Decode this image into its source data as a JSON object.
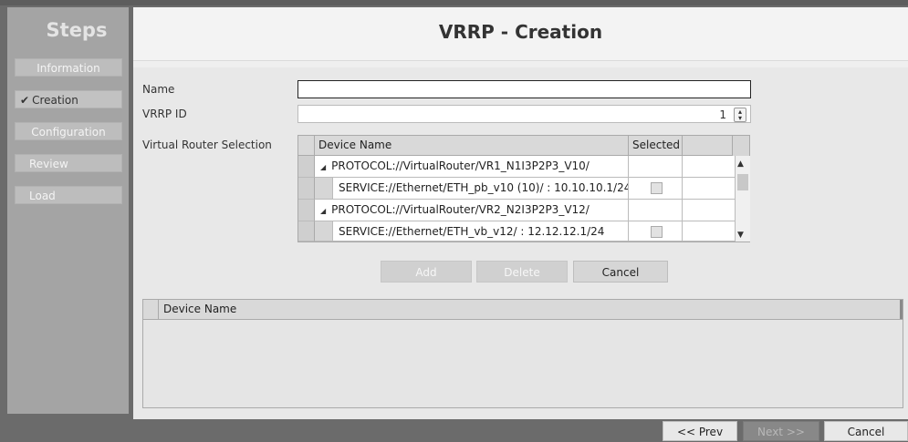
{
  "sidebar": {
    "title": "Steps",
    "steps": [
      {
        "label": "Information"
      },
      {
        "label": "Creation",
        "check": "✔"
      },
      {
        "label": "Configuration"
      },
      {
        "label": "Review"
      },
      {
        "label": "Load"
      }
    ]
  },
  "header": {
    "title": "VRRP - Creation"
  },
  "form": {
    "name_label": "Name",
    "name_value": "",
    "vrrp_id_label": "VRRP ID",
    "vrrp_id_value": "1",
    "virtual_router_label": "Virtual Router Selection"
  },
  "device_grid": {
    "columns": [
      "Device Name",
      "Selected"
    ],
    "rows": [
      {
        "text": "PROTOCOL://VirtualRouter/VR1_N1I3P2P3_V10/",
        "expander": "◢"
      },
      {
        "text": "SERVICE://Ethernet/ETH_pb_v10 (10)/ : 10.10.10.1/24",
        "selected": false
      },
      {
        "text": "PROTOCOL://VirtualRouter/VR2_N2I3P2P3_V12/",
        "expander": "◢"
      },
      {
        "text": "SERVICE://Ethernet/ETH_vb_v12/ : 12.12.12.1/24",
        "selected": false
      }
    ]
  },
  "actions": {
    "add": "Add",
    "delete": "Delete",
    "cancel": "Cancel"
  },
  "selected_grid": {
    "columns": [
      "Device Name"
    ]
  },
  "footer": {
    "prev": "<< Prev",
    "next": "Next >>",
    "cancel": "Cancel"
  },
  "icons": {
    "spinner": "spinner-updown-icon",
    "scroll_up": "▲",
    "scroll_down": "▼"
  }
}
